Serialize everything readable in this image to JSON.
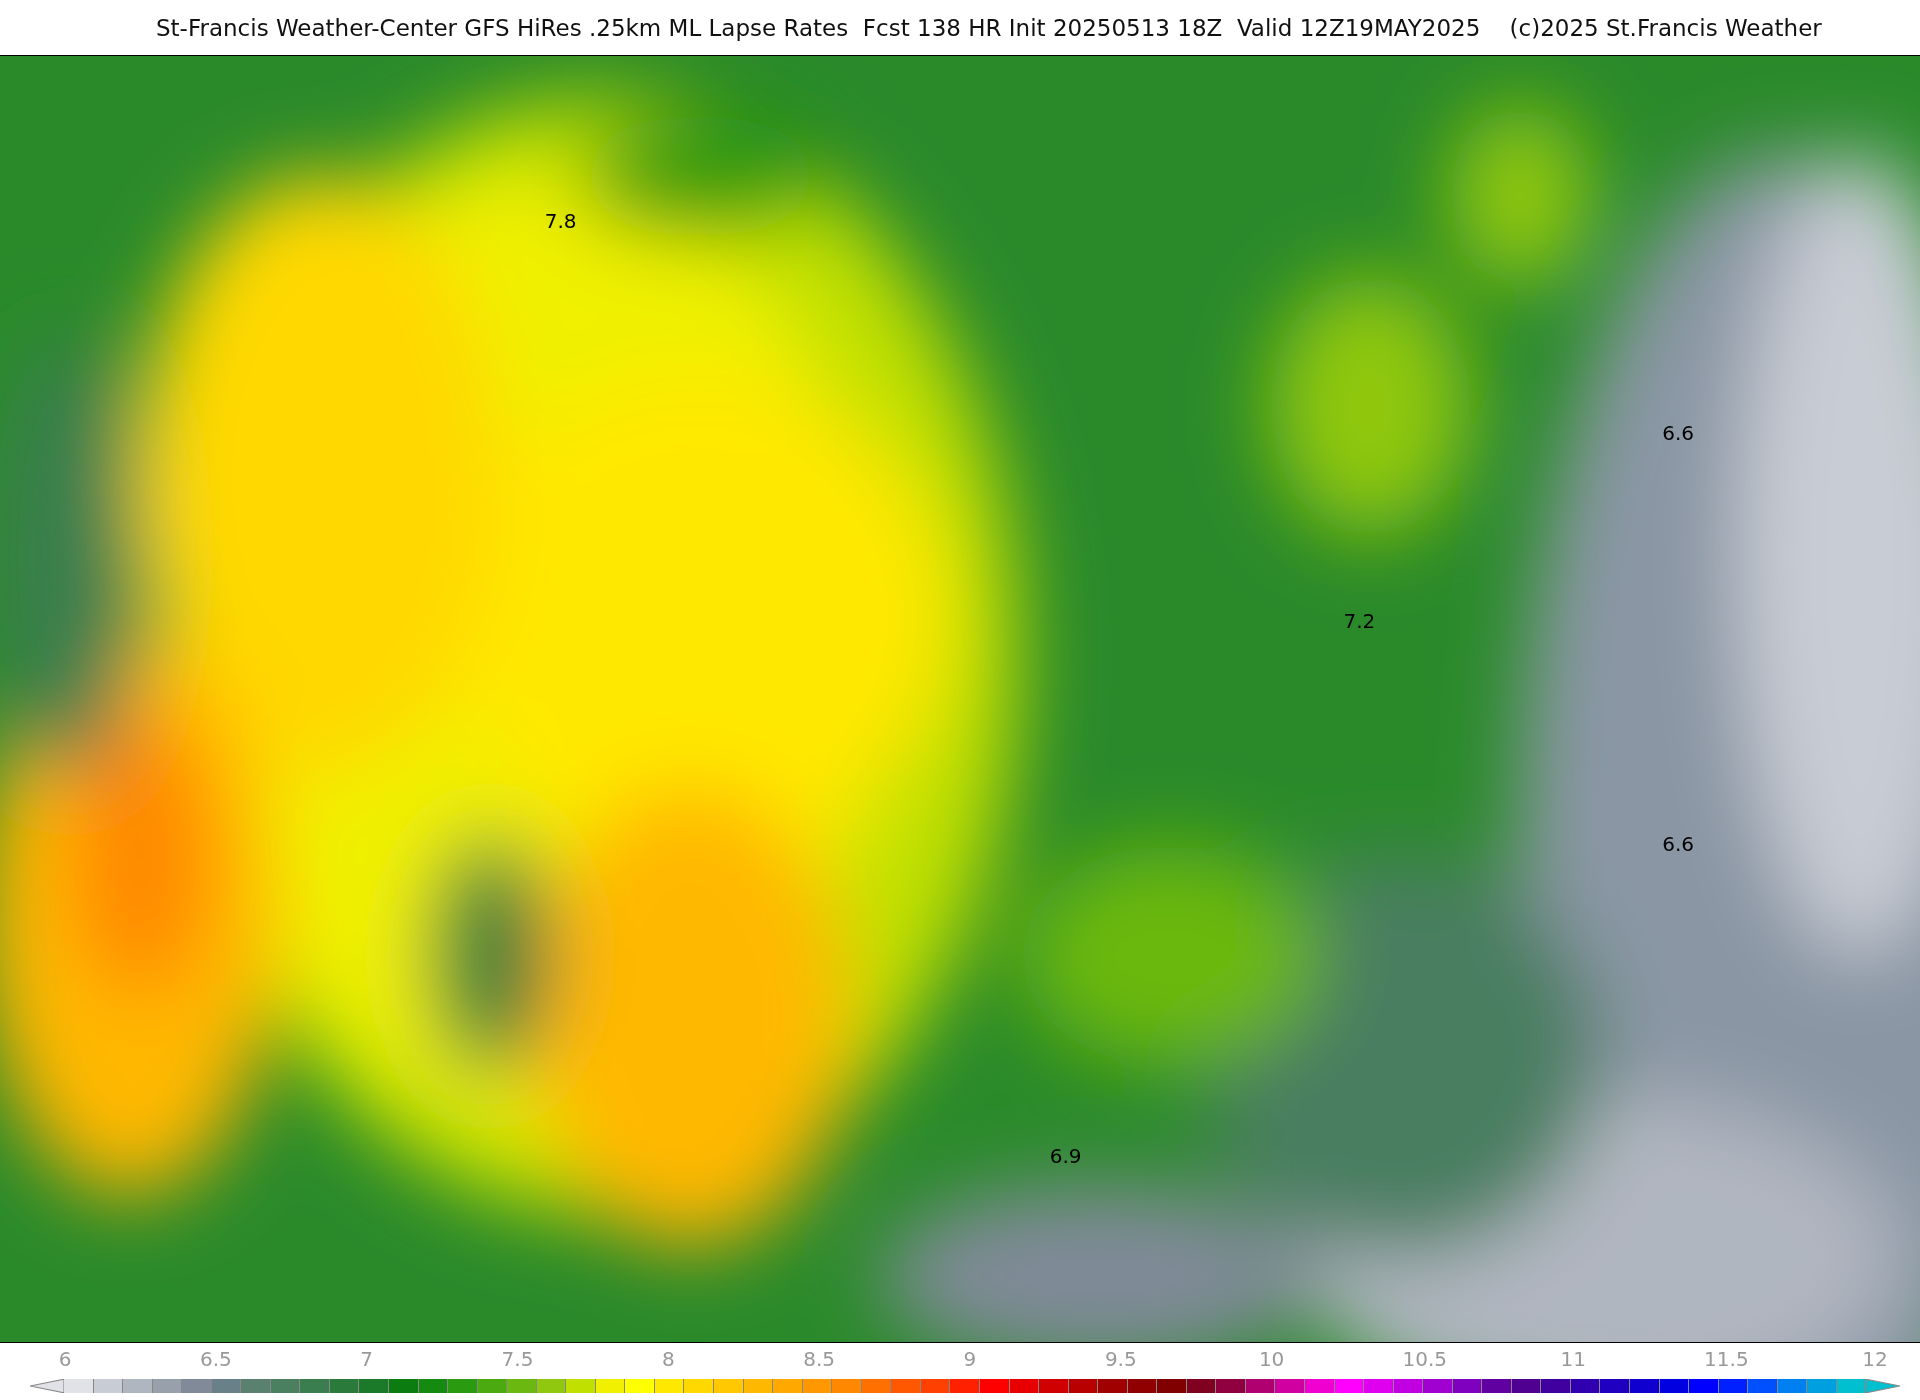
{
  "title": "St-Francis Weather-Center GFS HiRes .25km ML Lapse Rates  Fcst 138 HR Init 20250513 18Z  Valid 12Z19MAY2025    (c)2025 St.Francis Weather",
  "contour_labels": [
    "7.8",
    "7.2",
    "6.6",
    "6.6",
    "6.9"
  ],
  "colorbar": {
    "ticks": [
      "6",
      "6.5",
      "7",
      "7.5",
      "8",
      "8.5",
      "9",
      "9.5",
      "10",
      "10.5",
      "11",
      "11.5",
      "12"
    ]
  }
}
